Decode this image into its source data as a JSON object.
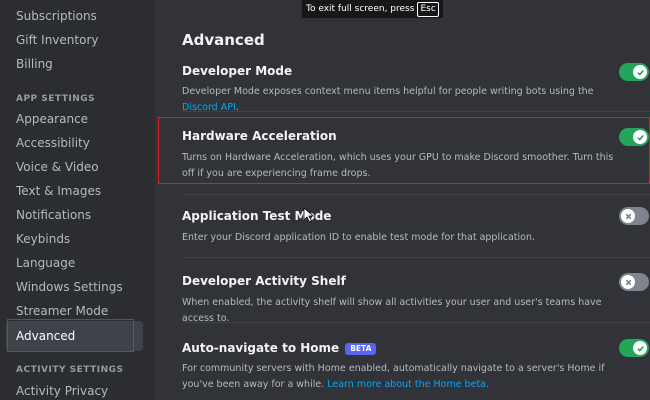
{
  "overlay": {
    "text": "To exit full screen, press",
    "key": "Esc"
  },
  "sidebar": {
    "items_top": [
      "Subscriptions",
      "Gift Inventory",
      "Billing"
    ],
    "app_settings_header": "APP SETTINGS",
    "app_items": [
      "Appearance",
      "Accessibility",
      "Voice & Video",
      "Text & Images",
      "Notifications",
      "Keybinds",
      "Language",
      "Windows Settings",
      "Streamer Mode",
      "Advanced"
    ],
    "activity_header": "ACTIVITY SETTINGS",
    "activity_items": [
      "Activity Privacy"
    ],
    "active_item": "Advanced"
  },
  "main": {
    "title": "Advanced",
    "settings": [
      {
        "name": "Developer Mode",
        "desc": "Developer Mode exposes context menu items helpful for people writing bots using the",
        "link": "Discord API",
        "desc_end": ".",
        "enabled": true
      },
      {
        "name": "Hardware Acceleration",
        "desc": "Turns on Hardware Acceleration, which uses your GPU to make Discord smoother. Turn this off if you are experiencing frame drops.",
        "enabled": true
      },
      {
        "name": "Application Test Mode",
        "desc": "Enter your Discord application ID to enable test mode for that application.",
        "enabled": false
      },
      {
        "name": "Developer Activity Shelf",
        "desc": "When enabled, the activity shelf will show all activities your user and user's teams have access to.",
        "enabled": false
      },
      {
        "name": "Auto-navigate to Home",
        "badge": "BETA",
        "desc": "For community servers with Home enabled, automatically navigate to a server's Home if you've been away for a while.",
        "link": "Learn more about the Home beta.",
        "enabled": true
      }
    ]
  },
  "colors": {
    "toggle_on": "#23a55a",
    "toggle_off": "#80848e",
    "highlight": "#d4202a",
    "link": "#00a8fc",
    "beta": "#5865f2"
  }
}
